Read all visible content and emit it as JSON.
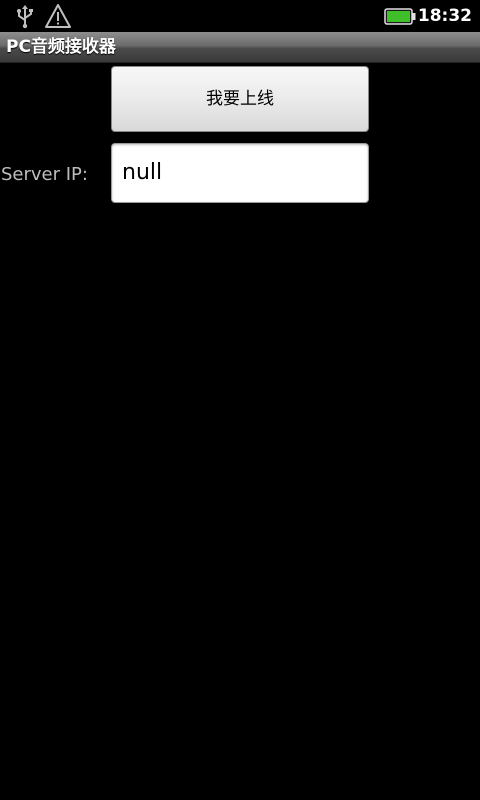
{
  "status_bar": {
    "time": "18:32",
    "icons": [
      "usb-icon",
      "warning-icon",
      "battery-icon"
    ],
    "battery_level": 1.0,
    "battery_color": "#3fbf2a"
  },
  "title_bar": {
    "title": "PC音频接收器"
  },
  "main": {
    "online_button_label": "我要上线",
    "server_ip_label": "Server IP:",
    "server_ip_value": "null"
  }
}
